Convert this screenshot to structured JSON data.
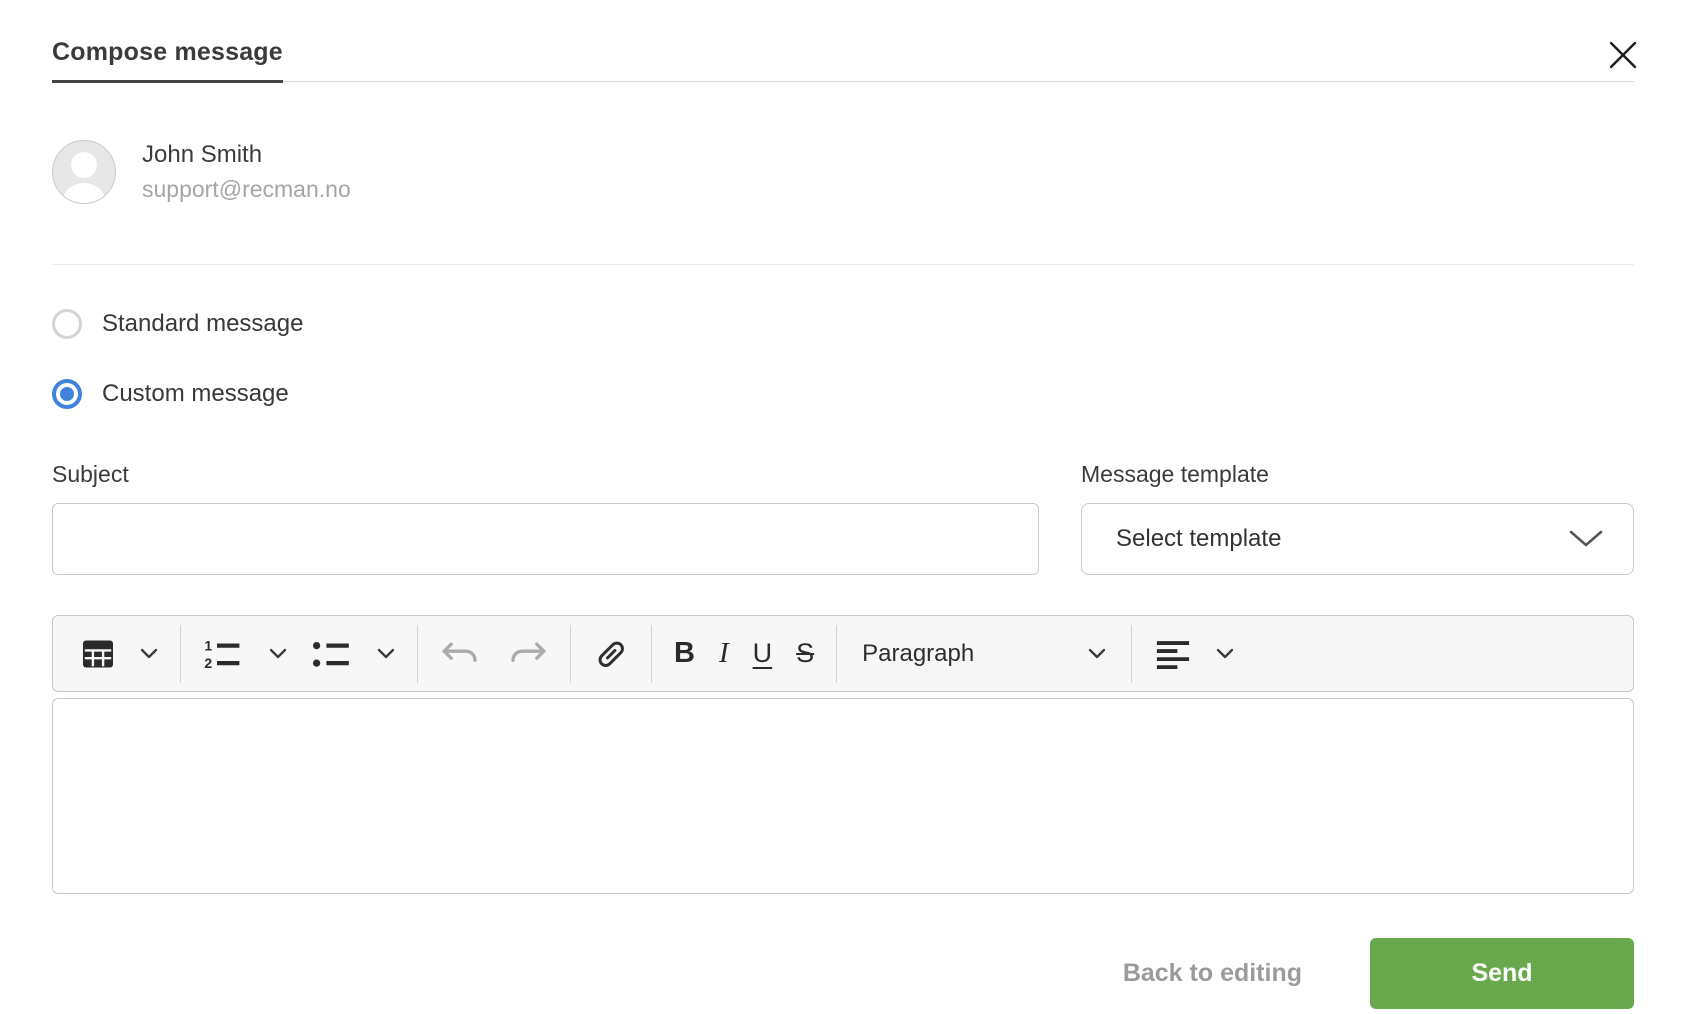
{
  "header": {
    "title": "Compose message"
  },
  "sender": {
    "name": "John Smith",
    "email": "support@recman.no"
  },
  "message_type": {
    "options": [
      {
        "label": "Standard message",
        "selected": false
      },
      {
        "label": "Custom message",
        "selected": true
      }
    ]
  },
  "form": {
    "subject_label": "Subject",
    "subject_value": "",
    "template_label": "Message template",
    "template_value": "Select template"
  },
  "editor": {
    "toolbar": {
      "paragraph_label": "Paragraph",
      "bold_label": "B",
      "italic_label": "I",
      "underline_label": "U",
      "strikethrough_label": "S",
      "icons": [
        "table",
        "ordered-list",
        "bullet-list",
        "undo",
        "redo",
        "link",
        "align-left"
      ],
      "undo_redo_disabled": true
    },
    "body_value": ""
  },
  "footer": {
    "back_label": "Back to editing",
    "send_label": "Send"
  },
  "icons": {
    "close": "✕",
    "person": "👤",
    "chevron-down": "⌄",
    "table": "▦",
    "ordered-list": "1.—",
    "bullet-list": "•—",
    "undo": "↶",
    "redo": "↷",
    "link": "🔗",
    "align-left": "≡"
  },
  "colors": {
    "accent_blue": "#3f83dc",
    "send_green": "#6aa84e",
    "border_gray": "#c9c9c9",
    "toolbar_bg": "#f7f7f7",
    "muted_text": "#a5a5a5"
  }
}
